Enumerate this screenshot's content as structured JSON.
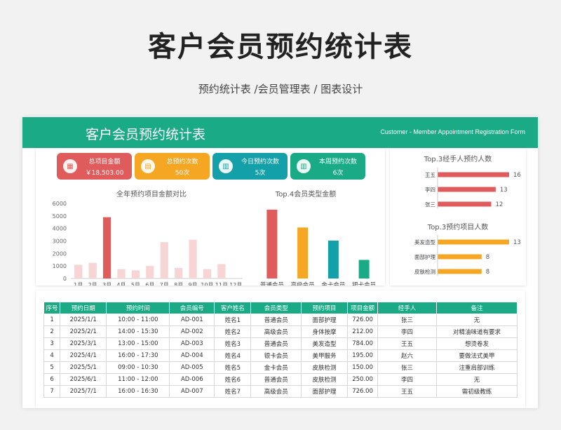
{
  "page": {
    "title": "客户会员预约统计表",
    "subtitle": "预约统计表 /会员管理表 / 图表设计"
  },
  "banner": {
    "title": "客户会员预约统计表",
    "en": "Customer - Member Appointment Registration Form"
  },
  "kpis": [
    {
      "label": "总项目金额",
      "value": "￥18,503.00",
      "color": "#e05c5c",
      "icon": "calendar-icon"
    },
    {
      "label": "总预约次数",
      "value": "50次",
      "color": "#f5a623",
      "icon": "document-icon"
    },
    {
      "label": "今日预约次数",
      "value": "5次",
      "color": "#13a0a8",
      "icon": "bar-chart-icon"
    },
    {
      "label": "本周预约次数",
      "value": "6次",
      "color": "#1aaa86",
      "icon": "bar-chart-icon"
    }
  ],
  "chart_data": [
    {
      "type": "bar",
      "title": "全年预约项目金额对比",
      "categories": [
        "1月",
        "2月",
        "3月",
        "4月",
        "5月",
        "6月",
        "7月",
        "8月",
        "9月",
        "10月",
        "11月",
        "12月"
      ],
      "values": [
        1100,
        1250,
        4900,
        750,
        650,
        1000,
        2900,
        850,
        3100,
        750,
        1150,
        0
      ],
      "yticks": [
        "0",
        "1000",
        "2000",
        "3000",
        "4000",
        "5000",
        "6000"
      ],
      "ylim": [
        0,
        6000
      ],
      "highlight_color": "#e05c5c",
      "base_color": "#f7d5d5",
      "highlight_index": 2
    },
    {
      "type": "bar",
      "title": "Top.4会员类型金额",
      "categories": [
        "普通会员",
        "高级会员",
        "金卡会员",
        "银卡会员"
      ],
      "values": [
        5000,
        3700,
        2750,
        1350
      ],
      "colors": [
        "#e05c5c",
        "#f5a623",
        "#13a0a8",
        "#1aaa86"
      ],
      "ylim": [
        0,
        5400
      ]
    },
    {
      "type": "bar",
      "title": "Top.3经手人预约人数",
      "categories": [
        "王五",
        "李四",
        "张三"
      ],
      "values": [
        16,
        13,
        12
      ],
      "color": "#e05c5c",
      "xlim": [
        0,
        16
      ]
    },
    {
      "type": "bar",
      "title": "Top.3预约项目人数",
      "categories": [
        "美发造型",
        "面部护理",
        "皮肤检测"
      ],
      "values": [
        13,
        8,
        8
      ],
      "color": "#f5a623",
      "xlim": [
        0,
        13
      ]
    }
  ],
  "table": {
    "headers": [
      "序号",
      "预约日期",
      "预约时间",
      "会员编号",
      "客户姓名",
      "会员类型",
      "预约项目",
      "项目金额",
      "经手人",
      "备注"
    ],
    "rows": [
      [
        "1",
        "2025/1/1",
        "10:00 - 11:00",
        "AD-001",
        "姓名1",
        "普通会员",
        "面部护理",
        "726.00",
        "张三",
        "无"
      ],
      [
        "2",
        "2025/2/1",
        "14:00 - 15:30",
        "AD-002",
        "姓名2",
        "高级会员",
        "身体按摩",
        "212.00",
        "李四",
        "对精油味道有要求"
      ],
      [
        "3",
        "2025/3/1",
        "13:00 - 15:00",
        "AD-003",
        "姓名3",
        "普通会员",
        "美发造型",
        "784.00",
        "王五",
        "想烫卷发"
      ],
      [
        "4",
        "2025/4/1",
        "16:00 - 17:30",
        "AD-004",
        "姓名4",
        "银卡会员",
        "美甲服务",
        "195.00",
        "赵六",
        "要做法式美甲"
      ],
      [
        "5",
        "2025/5/1",
        "09:00 - 10:30",
        "AD-005",
        "姓名5",
        "金卡会员",
        "皮肤检测",
        "150.00",
        "张三",
        "注重肩部训练"
      ],
      [
        "6",
        "2025/6/1",
        "11:00 - 12:00",
        "AD-006",
        "姓名6",
        "普通会员",
        "皮肤检测",
        "250.00",
        "李四",
        "无"
      ],
      [
        "7",
        "2025/7/1",
        "16:00 - 16:30",
        "AD-007",
        "姓名7",
        "高级会员",
        "面部护理",
        "726.00",
        "王五",
        "需初级教练"
      ]
    ]
  }
}
